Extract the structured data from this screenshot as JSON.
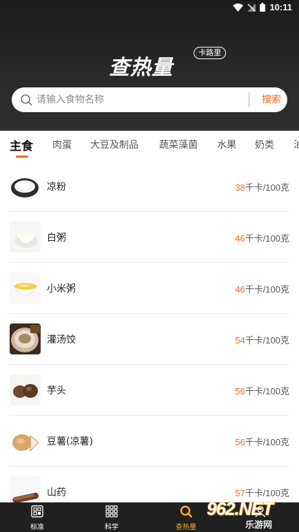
{
  "status_bar": {
    "time": "10:11"
  },
  "brand": {
    "title": "查热量",
    "subtitle": "卡路里"
  },
  "search": {
    "placeholder": "请输入食物名称",
    "value": "",
    "button_label": "搜索"
  },
  "tabs": [
    {
      "label": "主食",
      "active": true
    },
    {
      "label": "肉蛋",
      "active": false
    },
    {
      "label": "大豆及制品",
      "active": false
    },
    {
      "label": "蔬菜藻菌",
      "active": false
    },
    {
      "label": "水果",
      "active": false
    },
    {
      "label": "奶类",
      "active": false
    },
    {
      "label": "油",
      "active": false
    }
  ],
  "foods": [
    {
      "name": "凉粉",
      "kcal": "38",
      "unit": "千卡/100克"
    },
    {
      "name": "白粥",
      "kcal": "46",
      "unit": "千卡/100克"
    },
    {
      "name": "小米粥",
      "kcal": "46",
      "unit": "千卡/100克"
    },
    {
      "name": "灌汤饺",
      "kcal": "54",
      "unit": "千卡/100克"
    },
    {
      "name": "芋头",
      "kcal": "56",
      "unit": "千卡/100克"
    },
    {
      "name": "豆薯(凉薯)",
      "kcal": "56",
      "unit": "千卡/100克"
    },
    {
      "name": "山药",
      "kcal": "57",
      "unit": "千卡/100克"
    }
  ],
  "bottom_nav": [
    {
      "label": "标准",
      "icon": "scan-icon",
      "active": false
    },
    {
      "label": "科学",
      "icon": "grid-icon",
      "active": false
    },
    {
      "label": "查热量",
      "icon": "search-icon",
      "active": true
    },
    {
      "label": "",
      "icon": "profile-icon",
      "active": false
    }
  ],
  "watermark": {
    "logo": "962.NET",
    "subtitle": "乐游网"
  },
  "colors": {
    "accent": "#f06a1c",
    "nav_active": "#f5a623",
    "header_bg": "#222222",
    "nav_bg": "#202020"
  }
}
